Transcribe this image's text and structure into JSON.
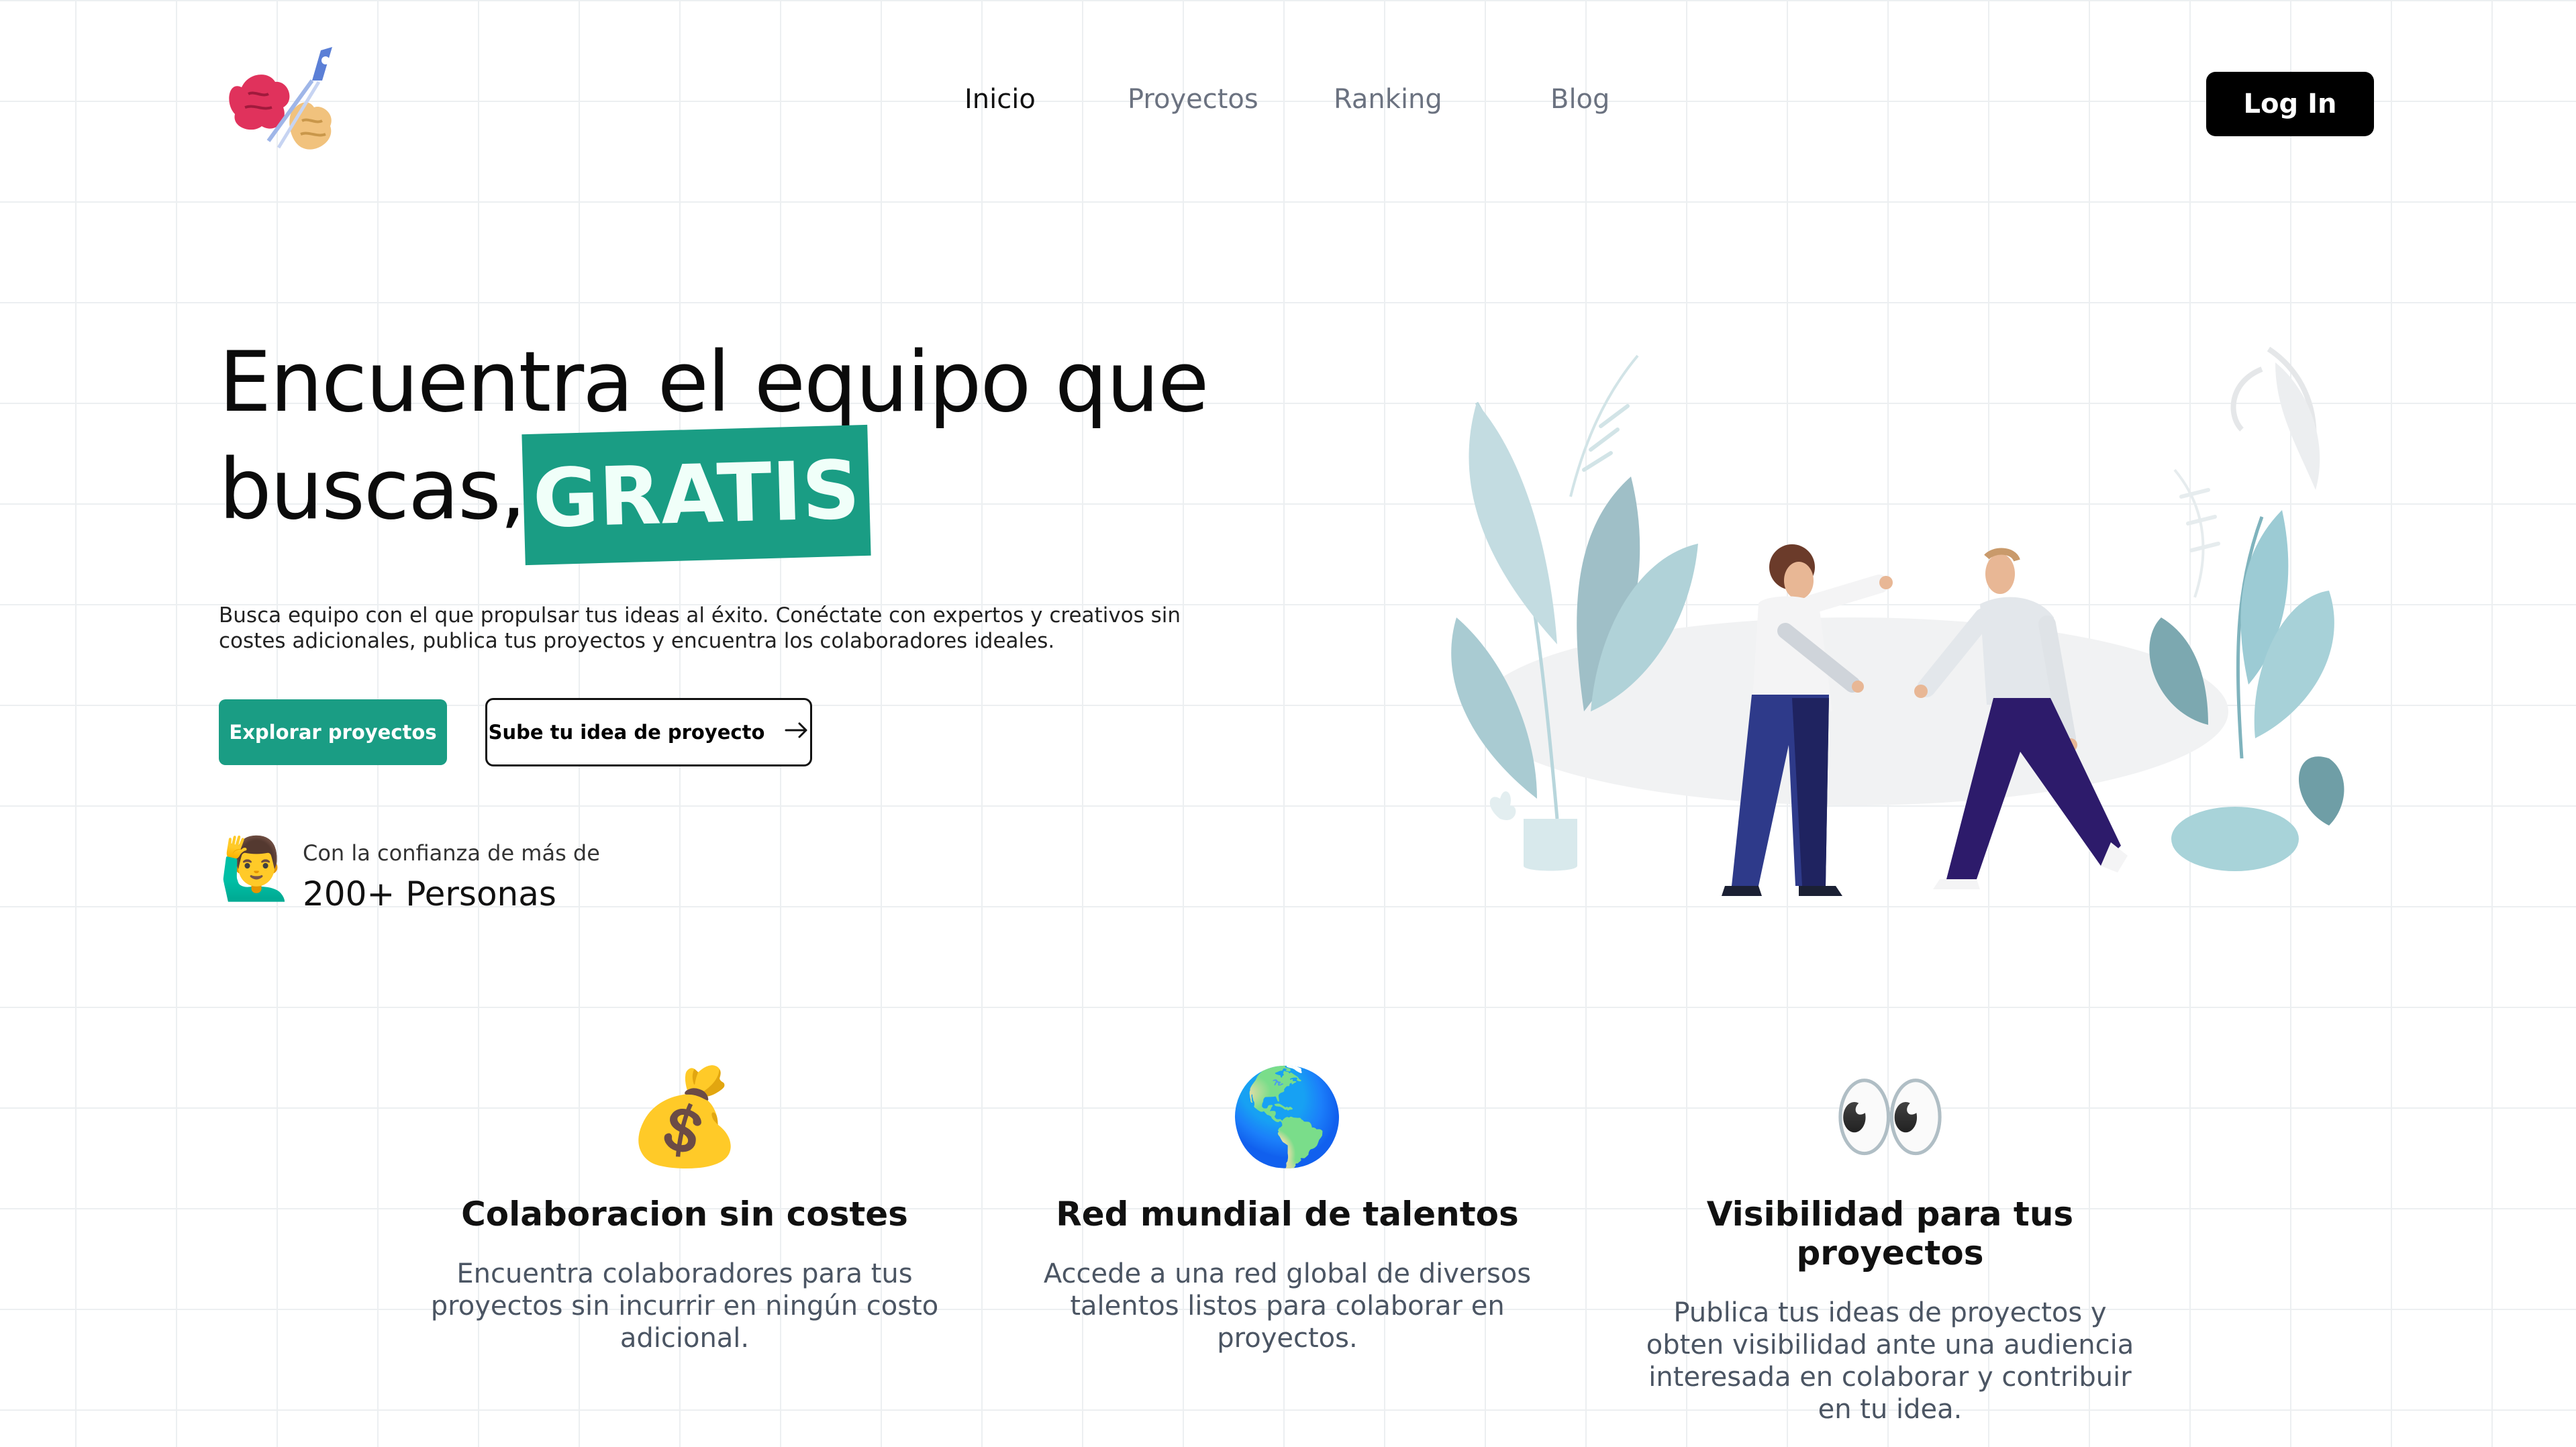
{
  "nav": {
    "items": [
      {
        "label": "Inicio",
        "active": true
      },
      {
        "label": "Proyectos",
        "active": false
      },
      {
        "label": "Ranking",
        "active": false
      },
      {
        "label": "Blog",
        "active": false
      }
    ],
    "login_label": "Log In"
  },
  "hero": {
    "title_line1": "Encuentra el equipo que",
    "title_line2": "buscas,",
    "highlight": "GRATIS",
    "description": "Busca equipo con el que propulsar tus ideas al éxito. Conéctate con expertos y creativos sin costes adicionales, publica tus proyectos y encuentra los colaboradores ideales.",
    "primary_button": "Explorar proyectos",
    "secondary_button": "Sube tu idea de proyecto",
    "trust_emoji": "🙋‍♂️",
    "trust_small": "Con la confianza de más de",
    "trust_big": "200+ Personas"
  },
  "features": [
    {
      "emoji": "💰",
      "icon": "money-bag-icon",
      "title": "Colaboracion sin costes",
      "text": "Encuentra colaboradores para tus proyectos sin incurrir en ningún costo adicional."
    },
    {
      "emoji": "🌎",
      "icon": "globe-icon",
      "title": "Red mundial de talentos",
      "text": "Accede a una red global de diversos talentos listos para colaborar en proyectos."
    },
    {
      "emoji": "👀",
      "icon": "eyes-icon",
      "title": "Visibilidad para tus proyectos",
      "text": "Publica tus ideas de proyectos y obten visibilidad ante una audiencia interesada en colaborar y contribuir en tu idea."
    }
  ],
  "colors": {
    "accent": "#1a9d84",
    "button_dark": "#000000",
    "grid": "#eceff1"
  }
}
